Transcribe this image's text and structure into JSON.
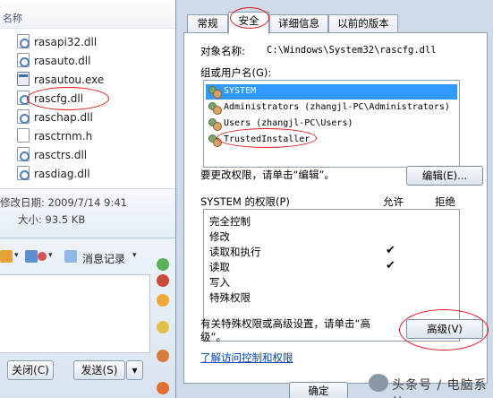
{
  "explorer": {
    "column_header": "名称",
    "files": [
      {
        "name": "rasapi32.dll",
        "type": "dll"
      },
      {
        "name": "rasauto.dll",
        "type": "dll"
      },
      {
        "name": "rasautou.exe",
        "type": "exe"
      },
      {
        "name": "rascfg.dll",
        "type": "dll"
      },
      {
        "name": "raschap.dll",
        "type": "dll"
      },
      {
        "name": "rasctrnm.h",
        "type": "h"
      },
      {
        "name": "rasctrs.dll",
        "type": "dll"
      },
      {
        "name": "rasdiag.dll",
        "type": "dll"
      }
    ],
    "details": {
      "modified": "修改日期: 2009/7/14 9:41",
      "size": "大小: 93.5 KB"
    }
  },
  "chat": {
    "toolbar_label": "消息记录",
    "close_button": "关闭(C)",
    "send_button": "发送(S)"
  },
  "dialog": {
    "tabs": [
      "常规",
      "安全",
      "详细信息",
      "以前的版本"
    ],
    "active_tab": "安全",
    "object_label": "对象名称:",
    "object_value": "C:\\Windows\\System32\\rascfg.dll",
    "group_label": "组或用户名(G):",
    "users": [
      "SYSTEM",
      "Administrators (zhangjl-PC\\Administrators)",
      "Users (zhangjl-PC\\Users)",
      "TrustedInstaller"
    ],
    "edit_hint": "要更改权限，请单击“编辑”。",
    "edit_button": "编辑(E)...",
    "perm_title": "SYSTEM 的权限(P)",
    "allow_header": "允许",
    "deny_header": "拒绝",
    "permissions": [
      {
        "name": "完全控制",
        "allow": false
      },
      {
        "name": "修改",
        "allow": false
      },
      {
        "name": "读取和执行",
        "allow": true
      },
      {
        "name": "读取",
        "allow": true
      },
      {
        "name": "写入",
        "allow": false
      },
      {
        "name": "特殊权限",
        "allow": false
      }
    ],
    "check_glyph": "✔",
    "advanced_hint_line1": "有关特殊权限或高级设置，请单击“高",
    "advanced_hint_line2": "级”。",
    "advanced_button": "高级(V)",
    "learn_link": "了解访问控制和权限",
    "ok_button": "确定"
  },
  "watermark": "头条号 / 电脑系统"
}
